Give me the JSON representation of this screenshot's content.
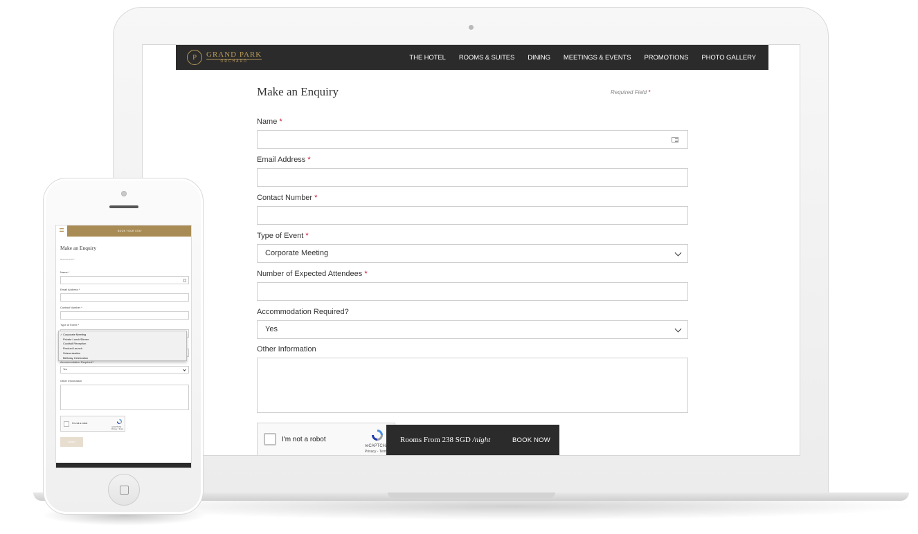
{
  "brand": {
    "name": "GRAND PARK",
    "sub": "ORCHARD",
    "emblem": "P"
  },
  "nav": {
    "items": [
      "THE HOTEL",
      "ROOMS & SUITES",
      "DINING",
      "MEETINGS & EVENTS",
      "PROMOTIONS",
      "PHOTO GALLERY"
    ]
  },
  "form": {
    "title": "Make an Enquiry",
    "required_note": "Required Field",
    "required_mark": "*",
    "fields": {
      "name": "Name",
      "email": "Email Address",
      "contact": "Contact Number",
      "event_type": "Type of Event",
      "event_type_value": "Corporate Meeting",
      "attendees": "Number of Expected Attendees",
      "accommodation": "Accommodation Required?",
      "accommodation_value": "Yes",
      "other": "Other Information"
    },
    "recaptcha": {
      "label": "I'm not a robot",
      "brand": "reCAPTCHA",
      "terms": "Privacy - Terms"
    }
  },
  "booking_bar": {
    "rate_prefix": "Rooms From 238 SGD",
    "rate_suffix": "/night",
    "button": "BOOK NOW"
  },
  "mobile": {
    "book_stay": "BOOK YOUR STAY",
    "title": "Make an Enquiry",
    "required_note": "Required Field *",
    "labels": {
      "name": "Name *",
      "email": "Email Address *",
      "contact": "Contact Number *",
      "event_type": "Type of Event *",
      "accommodation": "Accommodation Required?",
      "accommodation_value": "Yes",
      "other": "Other Information"
    },
    "event_options": [
      "Corporate Meeting",
      "Private Lunch/Dinner",
      "Cocktail Reception",
      "Product Launch",
      "Solemnisation",
      "Birthday Celebration"
    ],
    "recaptcha_label": "I'm not a robot",
    "recaptcha_brand": "reCAPTCHA",
    "recaptcha_terms": "Privacy - Terms",
    "submit": "SUBMIT"
  },
  "colors": {
    "nav_bg": "#2b2b2b",
    "gold": "#b8995a",
    "required": "#c8102e"
  }
}
